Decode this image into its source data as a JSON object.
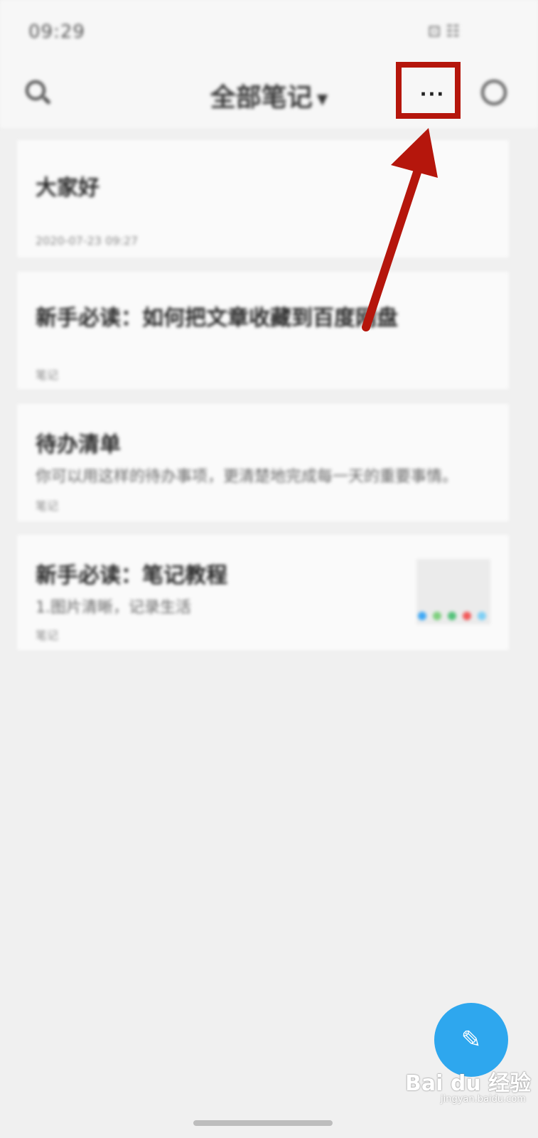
{
  "status_bar": {
    "time": "09:29",
    "indicators": "⊡ ☷"
  },
  "header": {
    "title": "全部笔记",
    "more_label": "···"
  },
  "notes": [
    {
      "title": "大家好",
      "snippet": "",
      "meta": "2020-07-23 09:27"
    },
    {
      "title": "新手必读：如何把文章收藏到百度网盘",
      "snippet": "",
      "meta": "笔记"
    },
    {
      "title": "待办清单",
      "snippet": "你可以用这样的待办事项，更清楚地完成每一天的重要事情。",
      "meta": "笔记"
    },
    {
      "title": "新手必读：笔记教程",
      "snippet": "1.图片清晰，记录生活",
      "meta": "笔记"
    }
  ],
  "thumb_dot_colors": [
    "#3fa9f5",
    "#7ed07e",
    "#53c27a",
    "#f25b5b",
    "#7fd0f5"
  ],
  "highlight_color": "#b5160c",
  "fab": {
    "icon": "edit-icon"
  },
  "watermark": {
    "brand": "Bai du 经验",
    "url": "jingyan.baidu.com"
  }
}
